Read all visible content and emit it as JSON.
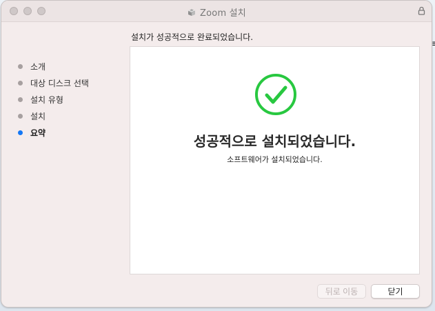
{
  "window": {
    "title": "Zoom 설치",
    "header_text": "설치가 성공적으로 완료되었습니다."
  },
  "sidebar": {
    "steps": [
      {
        "label": "소개",
        "active": false
      },
      {
        "label": "대상 디스크 선택",
        "active": false
      },
      {
        "label": "설치 유형",
        "active": false
      },
      {
        "label": "설치",
        "active": false
      },
      {
        "label": "요약",
        "active": true
      }
    ]
  },
  "content": {
    "main_message": "성공적으로 설치되었습니다.",
    "sub_message": "소프트웨어가 설치되었습니다."
  },
  "buttons": {
    "back_label": "뒤로 이동",
    "close_label": "닫기"
  },
  "icons": {
    "package": "package-icon",
    "lock": "lock-icon",
    "success": "checkmark-circle-icon"
  },
  "colors": {
    "success": "#28c840",
    "active_step": "#1377f5",
    "window_background": "#f4ecec"
  }
}
